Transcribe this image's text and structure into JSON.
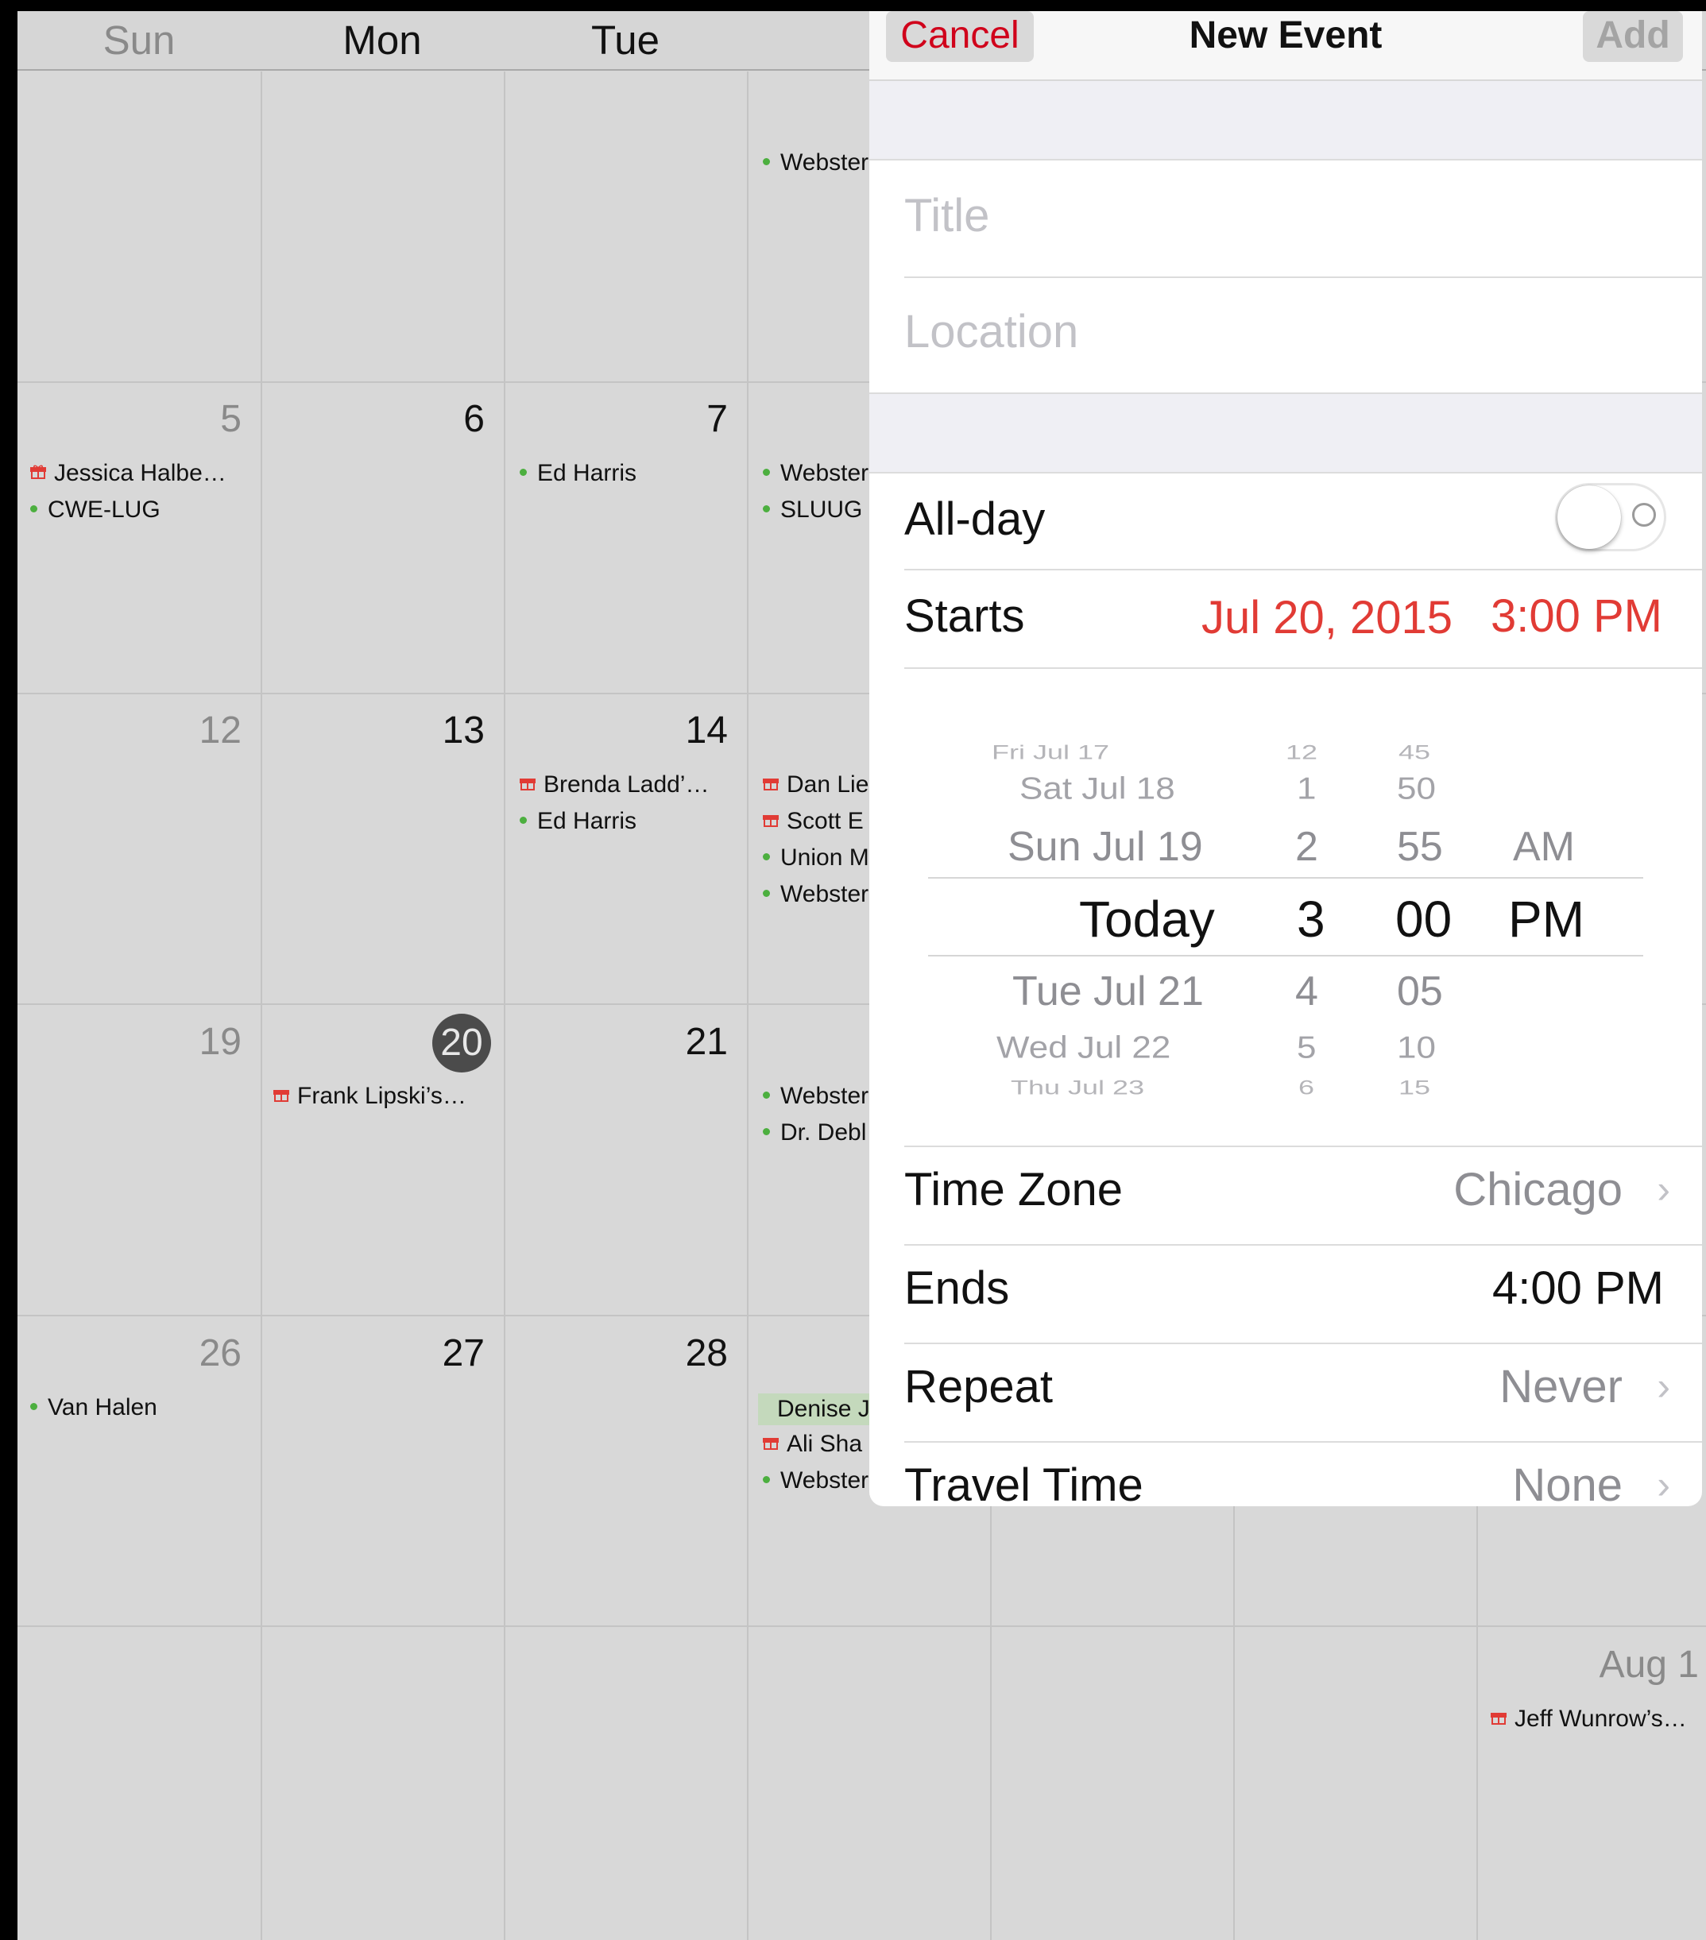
{
  "calendar": {
    "weekdays": [
      "Sun",
      "Mon",
      "Tue"
    ],
    "weeks": [
      {
        "days": [
          "",
          "",
          "",
          ""
        ]
      },
      {
        "days": [
          "5",
          "6",
          "7",
          ""
        ]
      },
      {
        "days": [
          "12",
          "13",
          "14",
          ""
        ]
      },
      {
        "days": [
          "19",
          "20",
          "21",
          ""
        ]
      },
      {
        "days": [
          "26",
          "27",
          "28",
          ""
        ]
      },
      {
        "days": [
          "",
          "",
          "",
          ""
        ]
      }
    ],
    "today": "20",
    "aug_label": "Aug 1",
    "events": {
      "w0_wed_1": "Webster",
      "w1_sun_1": "Jessica Halbe…",
      "w1_sun_2": "CWE-LUG",
      "w1_tue_1": "Ed Harris",
      "w1_wed_1": "Webster",
      "w1_wed_2": "SLUUG",
      "w2_tue_1": "Brenda Ladd’…",
      "w2_tue_2": "Ed Harris",
      "w2_wed_1": "Dan Lie",
      "w2_wed_2": "Scott E",
      "w2_wed_3": "Union M",
      "w2_wed_4": "Webster",
      "w3_mon_1": "Frank Lipski’s…",
      "w3_wed_1": "Webster",
      "w3_wed_2": "Dr. Debl",
      "w4_sun_1": "Van Halen",
      "w4_wed_1": "Denise J",
      "w4_wed_2": "Ali Sha",
      "w4_wed_3": "Webster",
      "w5_sat_1": "Jeff Wunrow’s…"
    },
    "colors": {
      "birthday": "#e13b35",
      "event_dot": "#4caf3f",
      "allday_bg": "#c4d9bc"
    }
  },
  "modal": {
    "cancel": "Cancel",
    "title": "New Event",
    "add": "Add",
    "title_placeholder": "Title",
    "location_placeholder": "Location",
    "allday_label": "All-day",
    "allday_on": false,
    "starts_label": "Starts",
    "starts_date": "Jul 20, 2015",
    "starts_time": "3:00 PM",
    "picker": {
      "dates": [
        "Fri Jul 17",
        "Sat Jul 18",
        "Sun Jul 19",
        "Today",
        "Tue Jul 21",
        "Wed Jul 22",
        "Thu Jul 23"
      ],
      "hours": [
        "12",
        "1",
        "2",
        "3",
        "4",
        "5",
        "6"
      ],
      "minutes": [
        "45",
        "50",
        "55",
        "00",
        "05",
        "10",
        "15"
      ],
      "ampm": [
        "AM",
        "PM"
      ]
    },
    "timezone_label": "Time Zone",
    "timezone_value": "Chicago",
    "ends_label": "Ends",
    "ends_value": "4:00 PM",
    "repeat_label": "Repeat",
    "repeat_value": "Never",
    "travel_label": "Travel Time",
    "travel_value": "None",
    "accent_color": "#e13b35"
  }
}
